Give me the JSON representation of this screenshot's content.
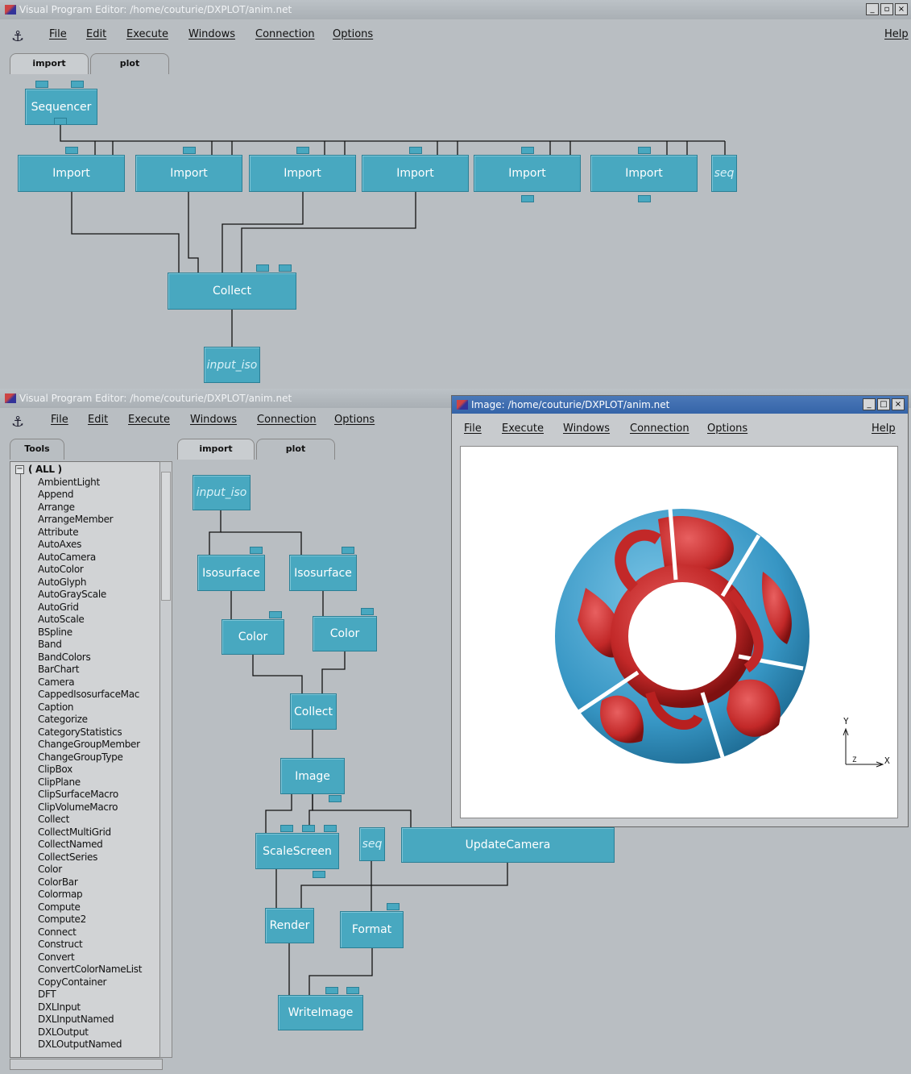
{
  "top_window": {
    "title": "Visual Program Editor: /home/couturie/DXPLOT/anim.net",
    "menu": [
      "File",
      "Edit",
      "Execute",
      "Windows",
      "Connection",
      "Options"
    ],
    "help": "Help",
    "tabs": [
      "import",
      "plot"
    ],
    "nodes": {
      "sequencer": "Sequencer",
      "import1": "Import",
      "import2": "Import",
      "import3": "Import",
      "import4": "Import",
      "import5": "Import",
      "import6": "Import",
      "seq": "seq",
      "collect": "Collect",
      "input_iso": "input_iso"
    }
  },
  "bottom_window": {
    "title": "Visual Program Editor: /home/couturie/DXPLOT/anim.net",
    "menu": [
      "File",
      "Edit",
      "Execute",
      "Windows",
      "Connection",
      "Options"
    ],
    "tools_tab": "Tools",
    "tabs": [
      "import",
      "plot"
    ],
    "tools": [
      "( ALL )",
      "AmbientLight",
      "Append",
      "Arrange",
      "ArrangeMember",
      "Attribute",
      "AutoAxes",
      "AutoCamera",
      "AutoColor",
      "AutoGlyph",
      "AutoGrayScale",
      "AutoGrid",
      "AutoScale",
      "BSpline",
      "Band",
      "BandColors",
      "BarChart",
      "Camera",
      "CappedIsosurfaceMac",
      "Caption",
      "Categorize",
      "CategoryStatistics",
      "ChangeGroupMember",
      "ChangeGroupType",
      "ClipBox",
      "ClipPlane",
      "ClipSurfaceMacro",
      "ClipVolumeMacro",
      "Collect",
      "CollectMultiGrid",
      "CollectNamed",
      "CollectSeries",
      "Color",
      "ColorBar",
      "Colormap",
      "Compute",
      "Compute2",
      "Connect",
      "Construct",
      "Convert",
      "ConvertColorNameList",
      "CopyContainer",
      "DFT",
      "DXLInput",
      "DXLInputNamed",
      "DXLOutput",
      "DXLOutputNamed"
    ],
    "nodes": {
      "input_iso": "input_iso",
      "iso1": "Isosurface",
      "iso2": "Isosurface",
      "color1": "Color",
      "color2": "Color",
      "collect": "Collect",
      "image": "Image",
      "scalescreen": "ScaleScreen",
      "seq": "seq",
      "updatecamera": "UpdateCamera",
      "render": "Render",
      "format": "Format",
      "writeimage": "WriteImage"
    }
  },
  "image_window": {
    "title": "Image: /home/couturie/DXPLOT/anim.net",
    "menu": [
      "File",
      "Execute",
      "Windows",
      "Connection",
      "Options"
    ],
    "help": "Help",
    "axis_y": "Y",
    "axis_x": "X",
    "axis_z": "Z"
  }
}
